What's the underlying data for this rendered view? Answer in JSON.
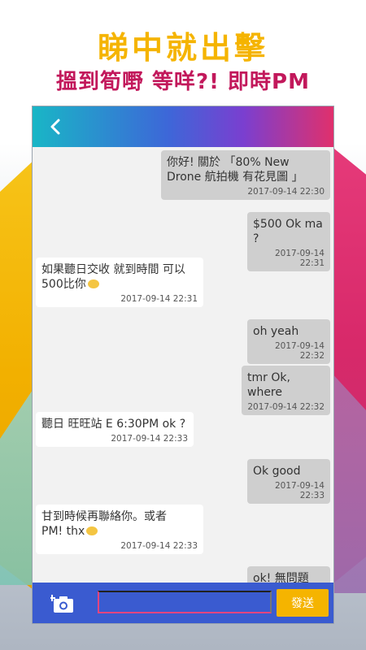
{
  "promo": {
    "headline": "睇中就出擊",
    "subheadline": "搵到筍嘢 等咩?! 即時PM"
  },
  "colors": {
    "headline": "#f5b400",
    "subheadline": "#c2185b",
    "input_bar": "#3a5bd0",
    "send_button": "#f5b400"
  },
  "appbar": {
    "back_icon": "chevron-left-icon"
  },
  "messages": [
    {
      "dir": "out",
      "text": "你好! 關於 「80% New\nDrone 航拍機 有花見圖 」",
      "time": "2017-09-14 22:30"
    },
    {
      "dir": "out",
      "text": "$500 Ok ma ?",
      "time": "2017-09-14 22:31"
    },
    {
      "dir": "in",
      "text": "如果聽日交收 就到時間 可以\n500比你",
      "time": "2017-09-14 22:31"
    },
    {
      "dir": "out",
      "text": "oh yeah",
      "time": "2017-09-14 22:32"
    },
    {
      "dir": "out",
      "text": "tmr Ok, where",
      "time": "2017-09-14 22:32"
    },
    {
      "dir": "in",
      "text": "聽日 旺旺站 E 6:30PM ok ?",
      "time": "2017-09-14 22:33"
    },
    {
      "dir": "out",
      "text": "Ok good",
      "time": "2017-09-14 22:33"
    },
    {
      "dir": "in",
      "text": "甘到時候再聯絡你。或者\nPM! thx",
      "time": "2017-09-14 22:33"
    },
    {
      "dir": "out",
      "text": "ok! 無問題",
      "time": ""
    }
  ],
  "composer": {
    "camera_icon": "camera-add-icon",
    "input_value": "",
    "send_label": "發送"
  }
}
